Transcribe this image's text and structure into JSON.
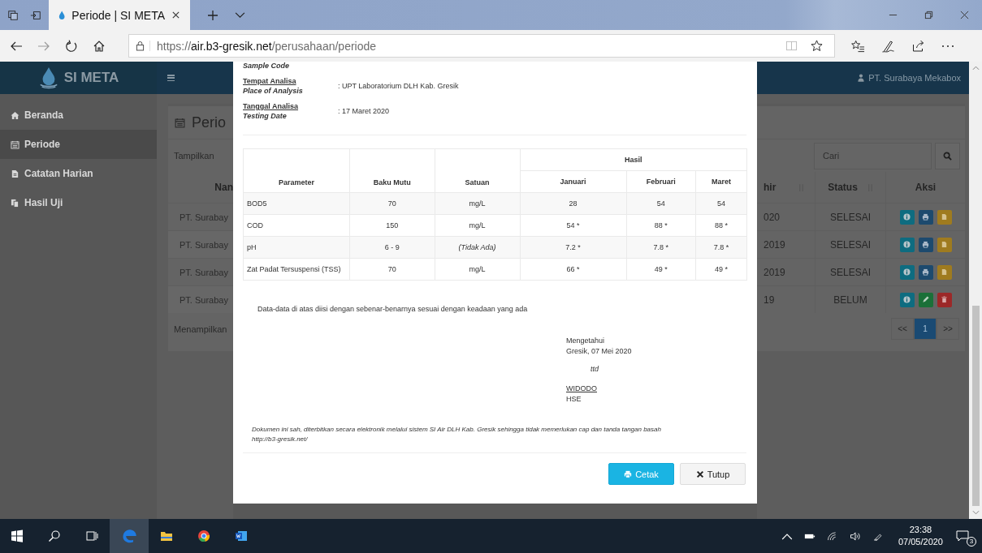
{
  "browser": {
    "tab": {
      "title": "Periode | SI META",
      "selected": true
    },
    "url_scheme": "https://",
    "url_host": "air.b3-gresik.net",
    "url_path": "/perusahaan/periode"
  },
  "app": {
    "brand": "SI META",
    "user": "PT. Surabaya Mekabox",
    "sidebar": [
      {
        "label": "Beranda",
        "selected": false
      },
      {
        "label": "Periode",
        "selected": true
      },
      {
        "label": "Catatan Harian",
        "selected": false
      },
      {
        "label": "Hasil Uji",
        "selected": false
      }
    ]
  },
  "page": {
    "title": "Perio",
    "show_label": "Tampilkan",
    "search_placeholder": "Cari",
    "info": "Menampilkan",
    "column_1": {
      "header": "Nan",
      "cells": [
        "PT. Surabay",
        "PT. Surabay",
        "PT. Surabay",
        "PT. Surabay"
      ]
    },
    "columns": [
      {
        "label": "hir",
        "sortable": true
      },
      {
        "label": "Status",
        "sortable": true
      },
      {
        "label": "Aksi",
        "sortable": false
      }
    ],
    "rows": [
      {
        "column_2": "020",
        "status": "SELESAI",
        "kind": "done"
      },
      {
        "column_2": "2019",
        "status": "SELESAI",
        "kind": "done"
      },
      {
        "column_2": "2019",
        "status": "SELESAI",
        "kind": "done"
      },
      {
        "column_2": "19",
        "status": "BELUM",
        "kind": "pending"
      }
    ],
    "pagination": {
      "prev": "<<",
      "pages": [
        {
          "label": "1",
          "selected": true
        }
      ],
      "next": ">>"
    }
  },
  "modal": {
    "fields": [
      {
        "label_en": "Sample Code"
      },
      {
        "label": "Tempat Analisa",
        "label_en": "Place of Analysis",
        "value": ": UPT Laboratorium DLH Kab. Gresik"
      },
      {
        "label": "Tanggal Analisa",
        "label_en": "Testing Date",
        "value": ": 17 Maret 2020"
      }
    ],
    "table": {
      "columns": [
        "Parameter",
        "Baku Mutu",
        "Satuan"
      ],
      "group": "Hasil",
      "months": [
        "Januari",
        "Februari",
        "Maret"
      ],
      "rows": [
        {
          "parameter": "BOD5",
          "standard": "70",
          "unit": "mg/L",
          "unit_available": true,
          "results": [
            "28",
            "54",
            "54"
          ]
        },
        {
          "parameter": "COD",
          "standard": "150",
          "unit": "mg/L",
          "unit_available": true,
          "results": [
            "54 *",
            "88 *",
            "88 *"
          ]
        },
        {
          "parameter": "pH",
          "standard": "6 - 9",
          "unit": "(Tidak Ada)",
          "unit_available": false,
          "results": [
            "7.2 *",
            "7.8 *",
            "7.8 *"
          ]
        },
        {
          "parameter": "Zat Padat Tersuspensi (TSS)",
          "standard": "70",
          "unit": "mg/L",
          "unit_available": true,
          "results": [
            "66 *",
            "49 *",
            "49 *"
          ]
        }
      ]
    },
    "statement": "Data-data di atas diisi dengan sebenar-benarnya sesuai dengan keadaan yang ada",
    "signature": {
      "heading": "Mengetahui",
      "place_date": "Gresik, 07 Mei 2020",
      "sign": "ttd",
      "name": "WIDODO",
      "position": "HSE"
    },
    "note": [
      "Dokumen ini sah, diterbitkan secara elektronik melalui sistem SI Air DLH Kab. Gresik sehingga tidak memerlukan cap dan tanda tangan basah",
      "http://b3-gresik.net/"
    ],
    "buttons": [
      {
        "label": "Cetak",
        "kind": "primary"
      },
      {
        "label": "Tutup",
        "kind": "default"
      }
    ]
  },
  "taskbar": {
    "time": "23:38",
    "date": "07/05/2020",
    "notifications": "3"
  }
}
